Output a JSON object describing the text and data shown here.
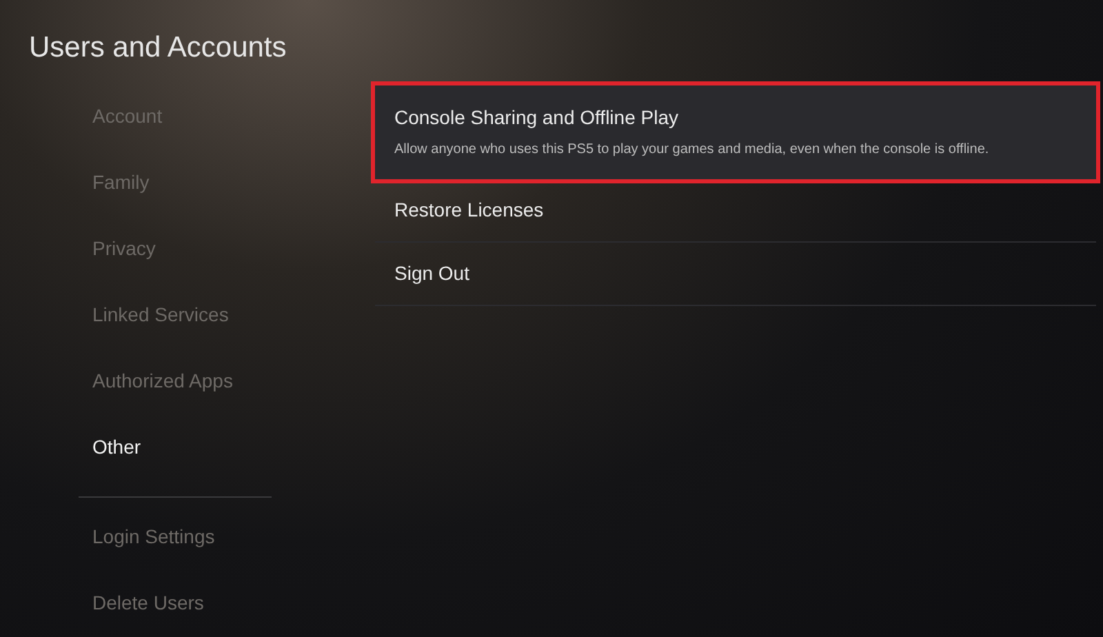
{
  "title": "Users and Accounts",
  "sidebar": {
    "groups": [
      [
        {
          "label": "Account",
          "selected": false
        },
        {
          "label": "Family",
          "selected": false
        },
        {
          "label": "Privacy",
          "selected": false
        },
        {
          "label": "Linked Services",
          "selected": false
        },
        {
          "label": "Authorized Apps",
          "selected": false
        },
        {
          "label": "Other",
          "selected": true
        }
      ],
      [
        {
          "label": "Login Settings",
          "selected": false
        },
        {
          "label": "Delete Users",
          "selected": false
        }
      ]
    ]
  },
  "options": [
    {
      "title": "Console Sharing and Offline Play",
      "description": "Allow anyone who uses this PS5 to play your games and media, even when the console is offline.",
      "focused": true,
      "annotated": true
    },
    {
      "title": "Restore Licenses",
      "focused": false,
      "annotated": false
    },
    {
      "title": "Sign Out",
      "focused": false,
      "annotated": false
    }
  ]
}
